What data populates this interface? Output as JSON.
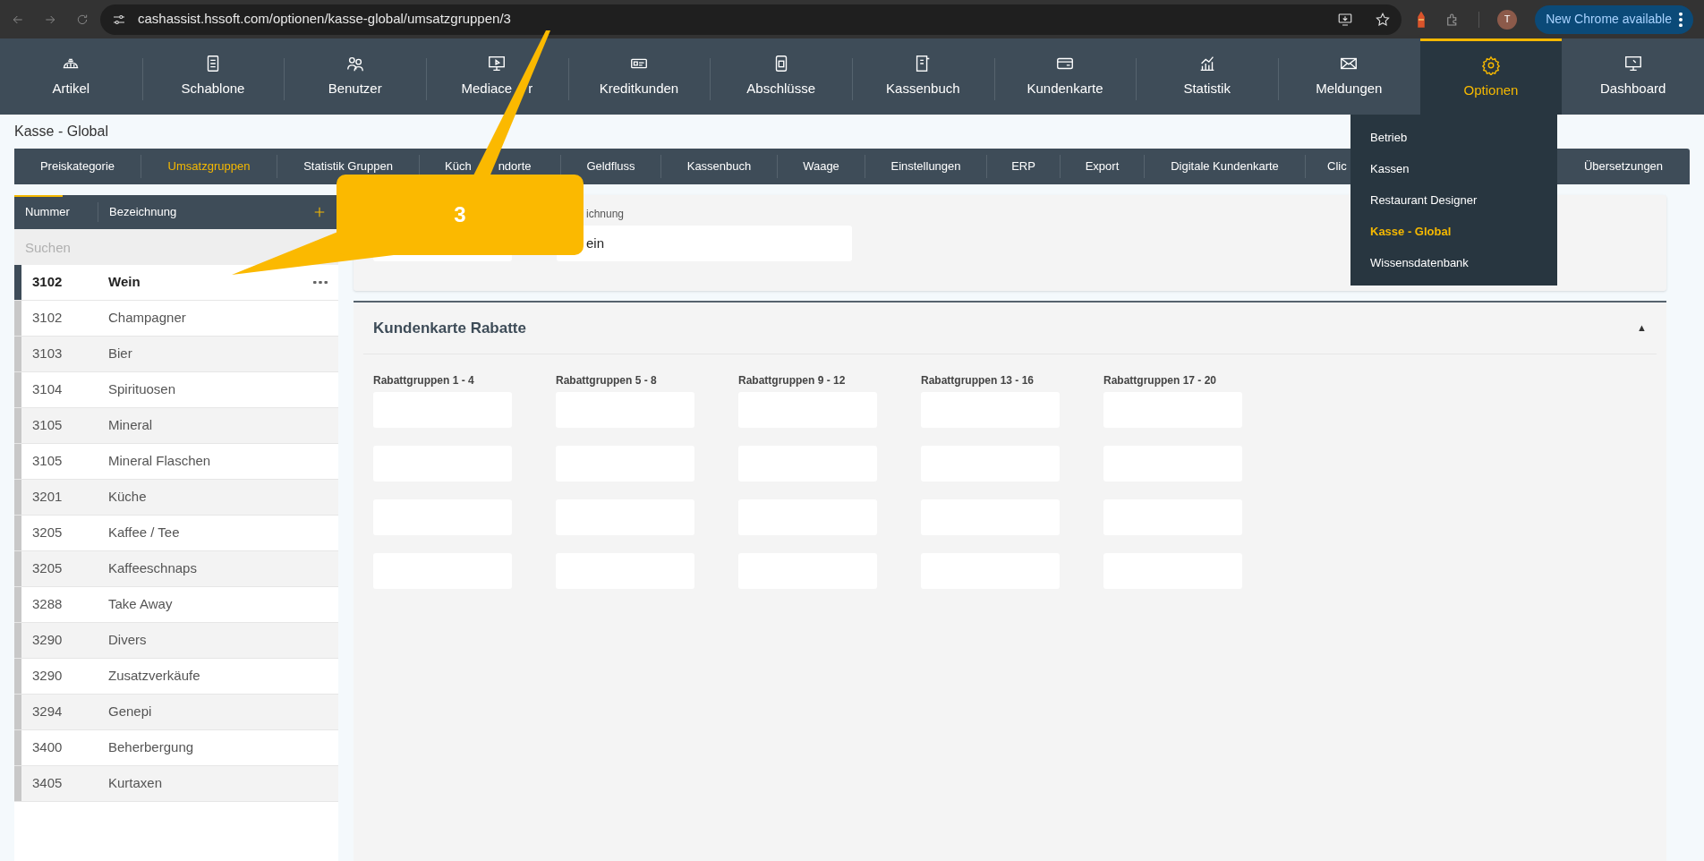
{
  "browser": {
    "url": "cashassist.hssoft.com/optionen/kasse-global/umsatzgruppen/3",
    "profile_initial": "T",
    "update_button": "New Chrome available"
  },
  "nav": [
    {
      "label": "Artikel",
      "selected": false
    },
    {
      "label": "Schablone",
      "selected": false
    },
    {
      "label": "Benutzer",
      "selected": false
    },
    {
      "label": "Mediace",
      "label_after": "r",
      "selected": false
    },
    {
      "label": "Kreditkunden",
      "selected": false
    },
    {
      "label": "Abschlüsse",
      "selected": false
    },
    {
      "label": "Kassenbuch",
      "selected": false
    },
    {
      "label": "Kundenkarte",
      "selected": false
    },
    {
      "label": "Statistik",
      "selected": false
    },
    {
      "label": "Meldungen",
      "selected": false
    },
    {
      "label": "Optionen",
      "selected": true
    },
    {
      "label": "Dashboard",
      "selected": false
    }
  ],
  "page_title": "Kasse - Global",
  "subtabs": [
    {
      "label": "Preiskategorie",
      "selected": false
    },
    {
      "label": "Umsatzgruppen",
      "selected": true
    },
    {
      "label": "Statistik Gruppen",
      "selected": false
    },
    {
      "label": "Küch",
      "label_after": "ndorte",
      "selected": false
    },
    {
      "label": "Geldfluss",
      "selected": false
    },
    {
      "label": "Kassenbuch",
      "selected": false
    },
    {
      "label": "Waage",
      "selected": false
    },
    {
      "label": "Einstellungen",
      "selected": false
    },
    {
      "label": "ERP",
      "selected": false
    },
    {
      "label": "Export",
      "selected": false
    },
    {
      "label": "Digitale Kundenkarte",
      "selected": false
    },
    {
      "label": "Clic",
      "selected": false
    },
    {
      "label": "Übersetzungen",
      "selected": false
    }
  ],
  "list": {
    "columns": [
      "Nummer",
      "Bezeichnung"
    ],
    "search_placeholder": "Suchen",
    "rows": [
      {
        "number": "3102",
        "name": "Wein",
        "selected": true
      },
      {
        "number": "3102",
        "name": "Champagner",
        "selected": false
      },
      {
        "number": "3103",
        "name": "Bier",
        "selected": false
      },
      {
        "number": "3104",
        "name": "Spirituosen",
        "selected": false
      },
      {
        "number": "3105",
        "name": "Mineral",
        "selected": false
      },
      {
        "number": "3105",
        "name": "Mineral Flaschen",
        "selected": false
      },
      {
        "number": "3201",
        "name": "Küche",
        "selected": false
      },
      {
        "number": "3205",
        "name": "Kaffee / Tee",
        "selected": false
      },
      {
        "number": "3205",
        "name": "Kaffeeschnaps",
        "selected": false
      },
      {
        "number": "3288",
        "name": "Take Away",
        "selected": false
      },
      {
        "number": "3290",
        "name": "Divers",
        "selected": false
      },
      {
        "number": "3290",
        "name": "Zusatzverkäufe",
        "selected": false
      },
      {
        "number": "3294",
        "name": "Genepi",
        "selected": false
      },
      {
        "number": "3400",
        "name": "Beherbergung",
        "selected": false
      },
      {
        "number": "3405",
        "name": "Kurtaxen",
        "selected": false
      }
    ]
  },
  "detail": {
    "name_field": {
      "label": "ichnung",
      "value": "ein"
    }
  },
  "discounts": {
    "title": "Kundenkarte Rabatte",
    "expanded": true,
    "toggle": "▲",
    "groups": [
      {
        "label": "Rabattgruppen 1 - 4"
      },
      {
        "label": "Rabattgruppen 5 - 8"
      },
      {
        "label": "Rabattgruppen 9 - 12"
      },
      {
        "label": "Rabattgruppen 13 - 16"
      },
      {
        "label": "Rabattgruppen 17 - 20"
      }
    ]
  },
  "menu": {
    "items": [
      {
        "label": "Betrieb",
        "selected": false
      },
      {
        "label": "Kassen",
        "selected": false
      },
      {
        "label": "Restaurant Designer",
        "selected": false
      },
      {
        "label": "Kasse - Global",
        "selected": true
      },
      {
        "label": "Wissensdatenbank",
        "selected": false
      }
    ]
  },
  "callout": {
    "label": "3"
  }
}
